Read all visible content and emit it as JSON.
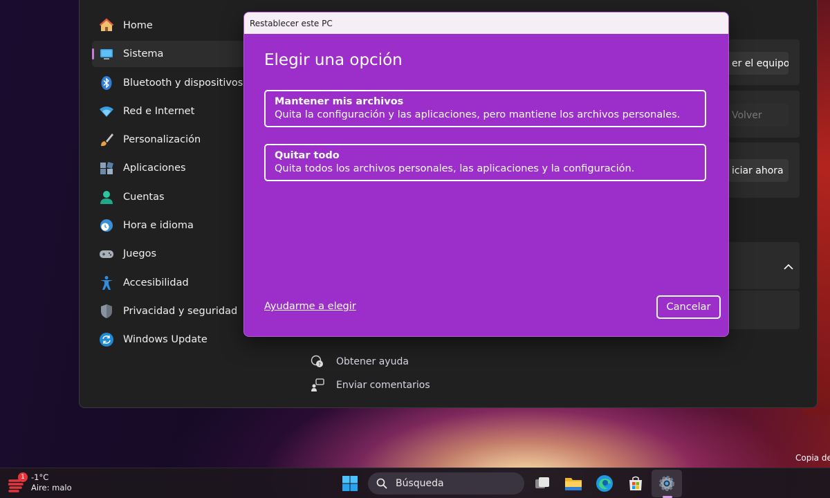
{
  "settings": {
    "nav": [
      {
        "label": "Home",
        "icon": "home-icon"
      },
      {
        "label": "Sistema",
        "icon": "system-icon"
      },
      {
        "label": "Bluetooth y dispositivos",
        "icon": "bluetooth-icon"
      },
      {
        "label": "Red e Internet",
        "icon": "wifi-icon"
      },
      {
        "label": "Personalización",
        "icon": "brush-icon"
      },
      {
        "label": "Aplicaciones",
        "icon": "apps-icon"
      },
      {
        "label": "Cuentas",
        "icon": "account-icon"
      },
      {
        "label": "Hora e idioma",
        "icon": "clock-globe-icon"
      },
      {
        "label": "Juegos",
        "icon": "gamepad-icon"
      },
      {
        "label": "Accesibilidad",
        "icon": "accessibility-icon"
      },
      {
        "label": "Privacidad y seguridad",
        "icon": "shield-icon"
      },
      {
        "label": "Windows Update",
        "icon": "update-icon"
      }
    ],
    "active_nav": "Sistema",
    "right_buttons": {
      "reset": "er el equipo",
      "back": "Volver",
      "restart": "iciar ahora"
    },
    "links": {
      "help": "Obtener ayuda",
      "feedback": "Enviar comentarios"
    }
  },
  "dialog": {
    "title": "Restablecer este PC",
    "heading": "Elegir una opción",
    "options": [
      {
        "title": "Mantener mis archivos",
        "desc": "Quita la configuración y las aplicaciones, pero mantiene los archivos personales."
      },
      {
        "title": "Quitar todo",
        "desc": "Quita todos los archivos personales, las aplicaciones y la configuración."
      }
    ],
    "help_link": "Ayudarme a elegir",
    "cancel": "Cancelar",
    "accent": "#9c2fc9"
  },
  "desktop": {
    "copy_text": "Copia de"
  },
  "taskbar": {
    "weather_temp": "-1°C",
    "weather_desc": "Aire: malo",
    "weather_badge": "1",
    "search_placeholder": "Búsqueda",
    "apps": [
      "start-icon",
      "task-view-icon",
      "file-explorer-icon",
      "edge-icon",
      "store-icon",
      "settings-icon"
    ]
  }
}
